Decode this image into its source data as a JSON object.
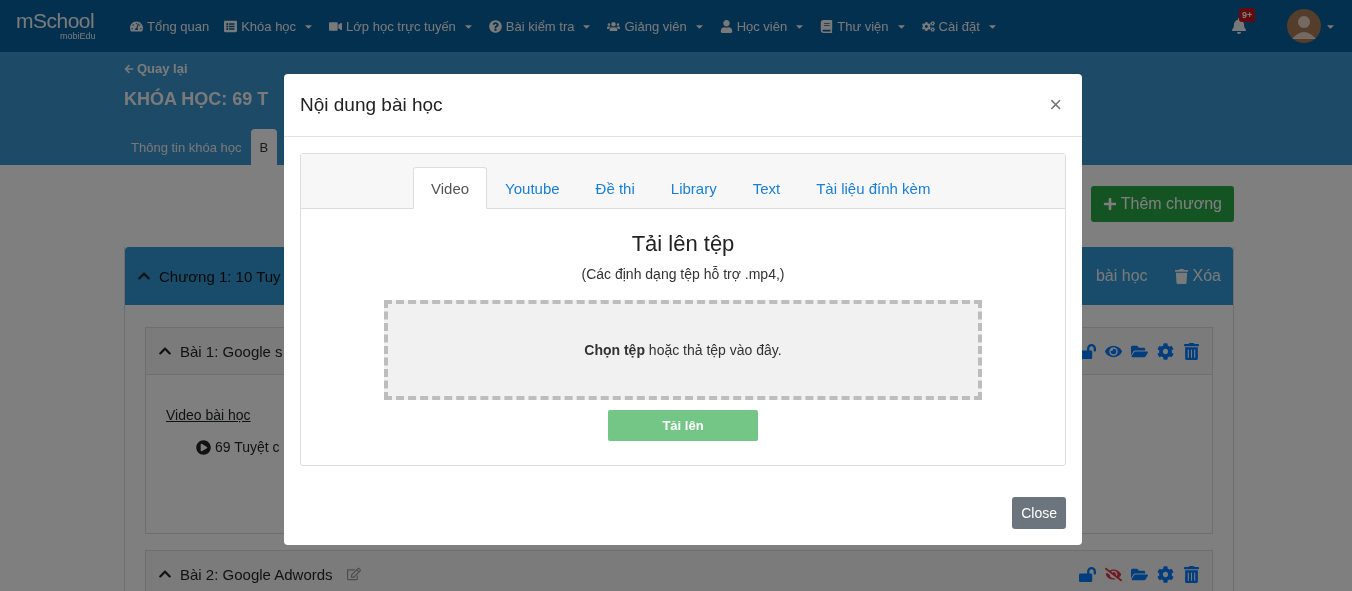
{
  "navbar": {
    "logo": {
      "name": "mSchool",
      "tagline": "mobiEdu"
    },
    "menu": [
      {
        "label": "Tổng quan",
        "dropdown": false
      },
      {
        "label": "Khóa học",
        "dropdown": true
      },
      {
        "label": "Lớp học trực tuyến",
        "dropdown": true
      },
      {
        "label": "Bài kiểm tra",
        "dropdown": true
      },
      {
        "label": "Giảng viên",
        "dropdown": true
      },
      {
        "label": "Học viên",
        "dropdown": true
      },
      {
        "label": "Thư viện",
        "dropdown": true
      },
      {
        "label": "Cài đặt",
        "dropdown": true
      }
    ],
    "notification_badge": "9+"
  },
  "header": {
    "back": "Quay lại",
    "title": "KHÓA HỌC: 69 T",
    "tabs": [
      {
        "label": "Thông tin khóa học",
        "selected": false
      },
      {
        "label": "B",
        "selected": true
      }
    ]
  },
  "add_chapter_button": "Thêm chương",
  "chapter": {
    "title": "Chương 1: 10 Tuy",
    "add_lesson": "bài học",
    "delete": "Xóa",
    "lessons": [
      {
        "title": "Bài 1: Google s",
        "visible": true,
        "expanded": true,
        "section": "Video bài học",
        "items": [
          "69 Tuyệt c"
        ]
      },
      {
        "title": "Bài 2: Google Adwords",
        "visible": false,
        "expanded": true
      }
    ]
  },
  "modal": {
    "title": "Nội dung bài học",
    "close_symbol": "×",
    "tabs": [
      {
        "label": "Video",
        "selected": true
      },
      {
        "label": "Youtube",
        "selected": false
      },
      {
        "label": "Đề thi",
        "selected": false
      },
      {
        "label": "Library",
        "selected": false
      },
      {
        "label": "Text",
        "selected": false
      },
      {
        "label": "Tài liệu đính kèm",
        "selected": false
      }
    ],
    "upload_title": "Tải lên tệp",
    "formats": "(Các định dạng tệp hỗ trợ .mp4,)",
    "dropzone": "**Chọn tệp** hoặc thả tệp vào đây.",
    "upload_button": {
      "label": "Tải lên",
      "disabled": true
    },
    "close_button": "Close"
  }
}
